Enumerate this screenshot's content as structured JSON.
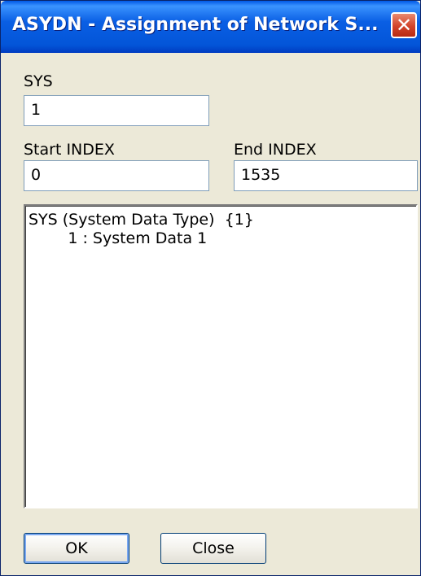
{
  "window": {
    "title": "ASYDN - Assignment of Network S...",
    "close_icon": "close-icon"
  },
  "form": {
    "sys_label": "SYS",
    "sys_value": "1",
    "start_index_label": "Start INDEX",
    "start_index_value": "0",
    "end_index_label": "End INDEX",
    "end_index_value": "1535"
  },
  "info_list": {
    "lines": [
      "SYS (System Data Type)  {1}",
      "        1 : System Data 1"
    ]
  },
  "buttons": {
    "ok_label": "OK",
    "close_label": "Close"
  }
}
